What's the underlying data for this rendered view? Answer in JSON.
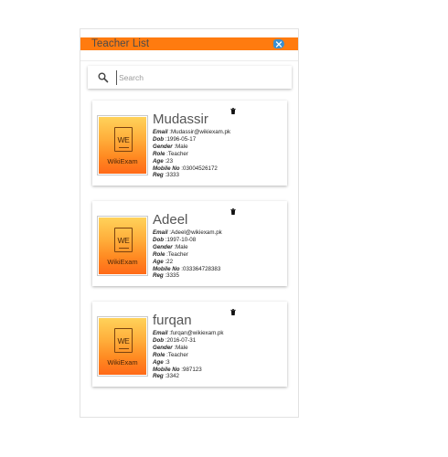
{
  "header": {
    "title": "Teacher List",
    "close_icon": "close-x-icon",
    "accent": "#ff7b0f",
    "close_color": "#3a8fd0"
  },
  "search": {
    "placeholder": "Search",
    "value": "",
    "icon": "search-icon"
  },
  "teachers": [
    {
      "name": "Mudassir",
      "logo_text": "WE",
      "logo_label": "WikiExam",
      "fields": [
        {
          "label": "Email",
          "value": "Mudassir@wikiexam.pk"
        },
        {
          "label": "Dob",
          "value": "1996-05-17"
        },
        {
          "label": "Gender",
          "value": "Male"
        },
        {
          "label": "Role",
          "value": "Teacher"
        },
        {
          "label": "Age",
          "value": "23"
        },
        {
          "label": "Mobile No",
          "value": "03004526172"
        },
        {
          "label": "Reg",
          "value": "3333"
        }
      ]
    },
    {
      "name": "Adeel",
      "logo_text": "WE",
      "logo_label": "WikiExam",
      "fields": [
        {
          "label": "Email",
          "value": "Adeel@wikiexam.pk"
        },
        {
          "label": "Dob",
          "value": "1997-10-08"
        },
        {
          "label": "Gender",
          "value": "Male"
        },
        {
          "label": "Role",
          "value": "Teacher"
        },
        {
          "label": "Age",
          "value": "22"
        },
        {
          "label": "Mobile No",
          "value": "033364728383"
        },
        {
          "label": "Reg",
          "value": "3335"
        }
      ]
    },
    {
      "name": "furqan",
      "logo_text": "WE",
      "logo_label": "WikiExam",
      "fields": [
        {
          "label": "Email",
          "value": "furqan@wikiexam.pk"
        },
        {
          "label": "Dob",
          "value": "2016-07-31"
        },
        {
          "label": "Gender",
          "value": "Male"
        },
        {
          "label": "Role",
          "value": "Teacher"
        },
        {
          "label": "Age",
          "value": "3"
        },
        {
          "label": "Mobile No",
          "value": "987123"
        },
        {
          "label": "Reg",
          "value": "3342"
        }
      ]
    }
  ]
}
